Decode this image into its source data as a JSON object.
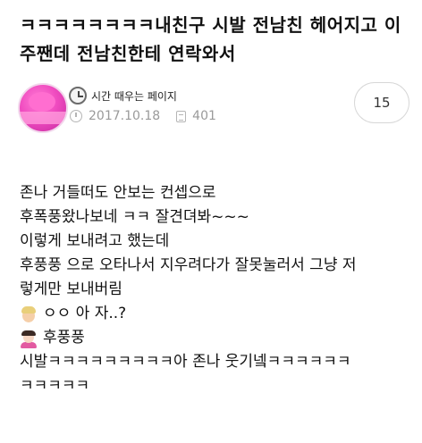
{
  "post": {
    "title": "ㅋㅋㅋㅋㅋㅋㅋㅋ내친구 시발 전남친 헤어지고 이주짼데 전남친한테 연락와서",
    "source_name": "시간 때우는 페이지",
    "date": "2017.10.18",
    "view_count": "401",
    "comment_count": "15",
    "icons": {
      "avatar": "profile-avatar",
      "source": "clock-icon",
      "date": "clock-icon",
      "views": "document-icon"
    }
  },
  "body": {
    "lines": [
      "존나 거들떠도 안보는 컨셉으로",
      "후폭풍왔나보네 ㅋㅋ 잘견뎌봐~~~",
      "이렇게 보내려고 했는데",
      "후풍풍 으로 오타나서 지우려다가 잘못눌러서 그냥 저",
      "렇게만 보내버림",
      "ㅇㅇ 아 자..?",
      "후풍풍",
      "시발ㅋㅋㅋㅋㅋㅋㅋㅋㅋ아 존나 웃기넼ㅋㅋㅋㅋㅋㅋ",
      "ㅋㅋㅋㅋㅋ"
    ],
    "emojis": {
      "line6": "man-emoji",
      "line7": "woman-tipping-hand-emoji"
    }
  }
}
